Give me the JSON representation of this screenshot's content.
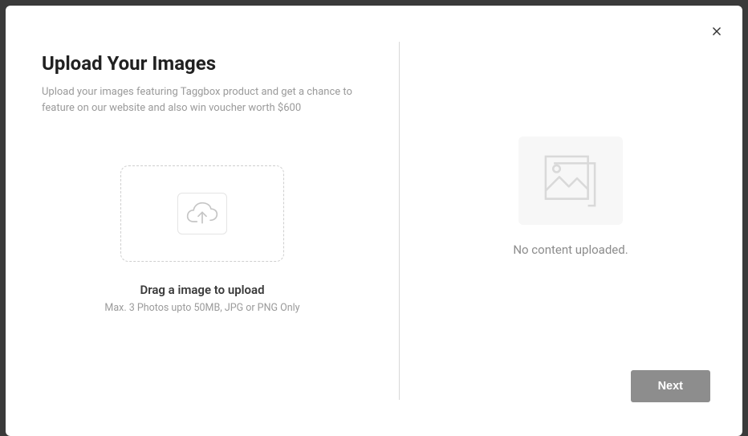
{
  "modal": {
    "title": "Upload Your Images",
    "subtitle": "Upload your images featuring Taggbox product and get a chance to feature on our website and also win voucher worth $600"
  },
  "dropzone": {
    "label": "Drag a image to upload",
    "hint": "Max. 3 Photos upto 50MB, JPG or PNG Only"
  },
  "preview": {
    "empty_text": "No content uploaded."
  },
  "actions": {
    "next_label": "Next"
  }
}
